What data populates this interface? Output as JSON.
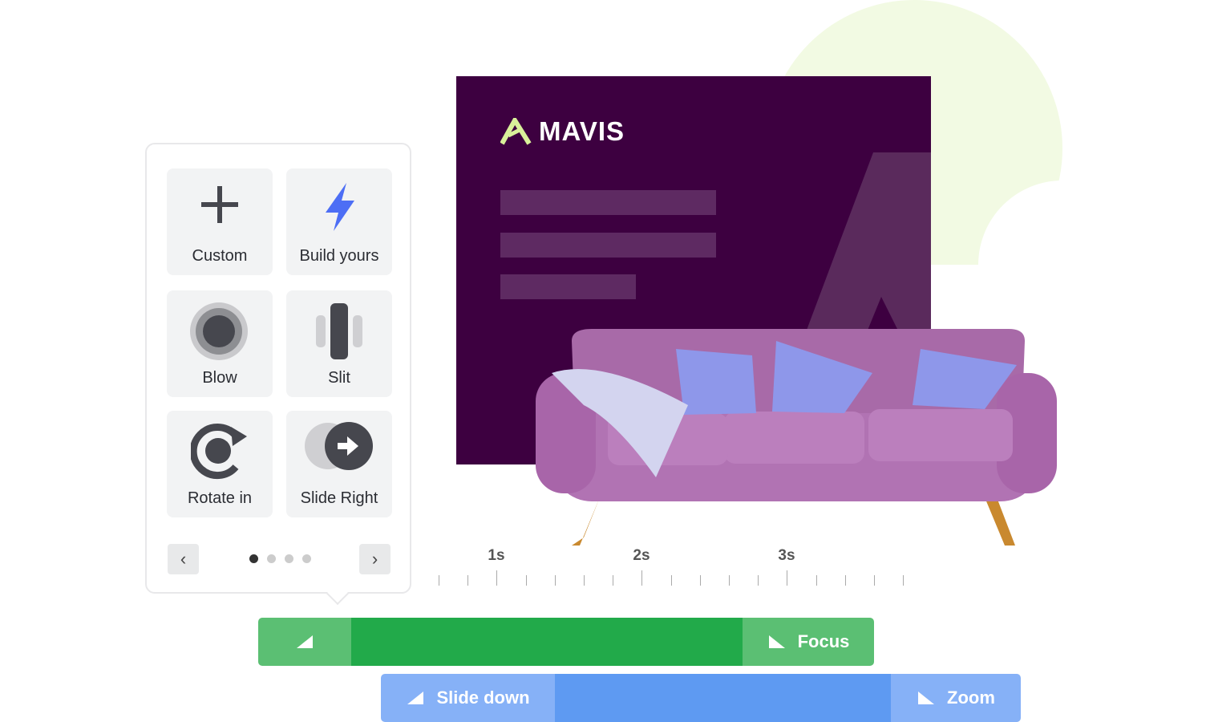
{
  "colors": {
    "slide_bg": "#3d0040",
    "accent_green": "#22aa4a",
    "accent_blue": "#5e9af2",
    "lime": "#d9f09a",
    "bolt": "#4d6ef5"
  },
  "slide": {
    "logo_text": "MAVIS"
  },
  "panel": {
    "cards": [
      {
        "label": "Custom",
        "icon": "plus-icon"
      },
      {
        "label": "Build yours",
        "icon": "lightning-icon"
      },
      {
        "label": "Blow",
        "icon": "blow-icon"
      },
      {
        "label": "Slit",
        "icon": "slit-icon"
      },
      {
        "label": "Rotate in",
        "icon": "rotate-icon"
      },
      {
        "label": "Slide Right",
        "icon": "slide-right-icon"
      }
    ],
    "page_count": 4,
    "current_page": 1,
    "prev_label": "‹",
    "next_label": "›"
  },
  "timeline": {
    "labels": [
      "1s",
      "2s",
      "3s"
    ],
    "tracks": [
      {
        "exit": "Focus"
      },
      {
        "enter": "Slide down",
        "exit": "Zoom"
      }
    ]
  }
}
